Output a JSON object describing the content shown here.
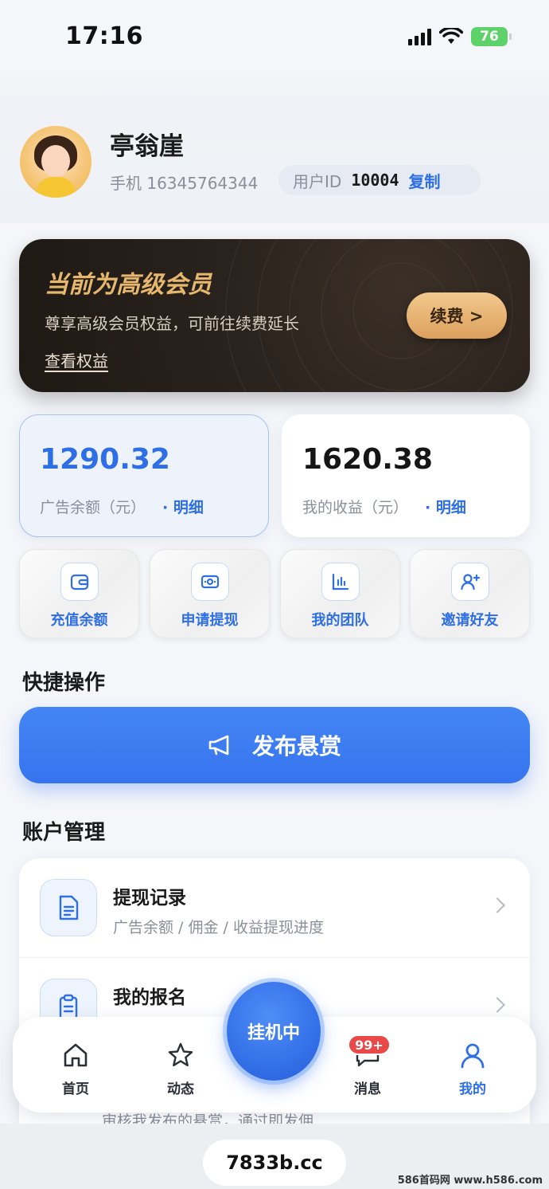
{
  "status_bar": {
    "time": "17:16",
    "battery": "76"
  },
  "profile": {
    "name": "亭翁崖",
    "phone": "手机 16345764344",
    "id_label": "用户ID",
    "id_value": "10004",
    "copy_label": "复制"
  },
  "vip": {
    "title": "当前为高级会员",
    "subtitle": "尊享高级会员权益，可前往续费延长",
    "link": "查看权益",
    "renew": "续费 >"
  },
  "balances": {
    "ad": {
      "value": "1290.32",
      "label": "广告余额（元）",
      "detail": "· 明细"
    },
    "income": {
      "value": "1620.38",
      "label": "我的收益（元）",
      "detail": "· 明细"
    }
  },
  "tiles": [
    {
      "label": "充值余额",
      "icon": "wallet-icon"
    },
    {
      "label": "申请提现",
      "icon": "cash-icon"
    },
    {
      "label": "我的团队",
      "icon": "chart-icon"
    },
    {
      "label": "邀请好友",
      "icon": "add-user-icon"
    }
  ],
  "quick": {
    "title": "快捷操作",
    "publish": "发布悬赏"
  },
  "account": {
    "title": "账户管理",
    "items": [
      {
        "title": "提现记录",
        "subtitle": "广告余额 / 佣金 / 收益提现进度"
      },
      {
        "title": "我的报名",
        "subtitle": ""
      }
    ],
    "peek": "审核我发布的悬赏，通过即发佣"
  },
  "tabbar": {
    "home": "首页",
    "feed": "动态",
    "center": "挂机中",
    "messages": "消息",
    "badge": "99+",
    "mine": "我的"
  },
  "footer": {
    "domain": "7833b.cc",
    "watermark": "586首码网 www.h586.com"
  },
  "colors": {
    "accent": "#2f6fe6",
    "gold": "#e7b76e",
    "badge": "#e94948"
  }
}
